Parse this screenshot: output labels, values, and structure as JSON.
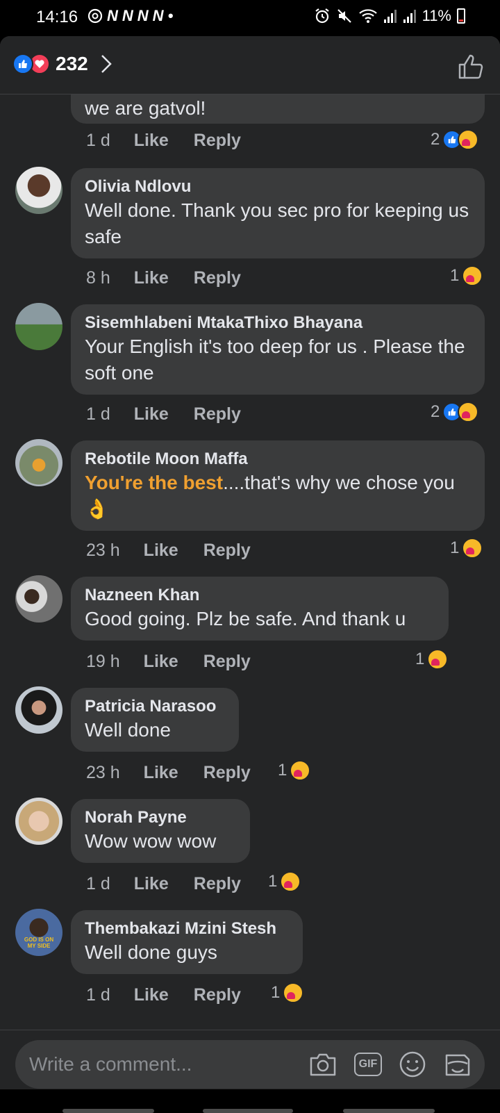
{
  "status_bar": {
    "time": "14:16",
    "left_icons": [
      "at-icon",
      "N",
      "N",
      "N",
      "N",
      "•"
    ],
    "battery": "11%"
  },
  "header": {
    "reaction_count": "232"
  },
  "partial_comment": {
    "text": "we are gatvol!",
    "time": "1 d",
    "like": "Like",
    "reply": "Reply",
    "reaction_count": "2"
  },
  "comments": [
    {
      "author": "Olivia Ndlovu",
      "text": "Well done. Thank you sec pro for keeping us safe",
      "time": "8 h",
      "like": "Like",
      "reply": "Reply",
      "reaction_count": "1"
    },
    {
      "author": "Sisemhlabeni MtakaThixo Bhayana",
      "text": "Your English it's too deep for us   . Please the soft one",
      "time": "1 d",
      "like": "Like",
      "reply": "Reply",
      "reaction_count": "2"
    },
    {
      "author": "Rebotile Moon Maffa",
      "highlight": "You're the best",
      "text": "....that's why we chose you👌",
      "time": "23 h",
      "like": "Like",
      "reply": "Reply",
      "reaction_count": "1"
    },
    {
      "author": "Nazneen Khan",
      "text": "Good going. Plz be safe. And thank u",
      "time": "19 h",
      "like": "Like",
      "reply": "Reply",
      "reaction_count": "1"
    },
    {
      "author": "Patricia Narasoo",
      "text": "Well done",
      "time": "23 h",
      "like": "Like",
      "reply": "Reply",
      "reaction_count": "1"
    },
    {
      "author": "Norah Payne",
      "text": "Wow wow wow",
      "time": "1 d",
      "like": "Like",
      "reply": "Reply",
      "reaction_count": "1"
    },
    {
      "author": "Thembakazi Mzini Stesh",
      "text": "Well done guys",
      "time": "1 d",
      "like": "Like",
      "reply": "Reply",
      "reaction_count": "1",
      "avatar_text": "GOD IS ON MY SIDE"
    }
  ],
  "composer": {
    "placeholder": "Write a comment...",
    "gif_label": "GIF"
  },
  "colors": {
    "background": "#242526",
    "bubble": "#3a3b3c",
    "accent_blue": "#1877f2",
    "highlight": "#f0a030"
  }
}
